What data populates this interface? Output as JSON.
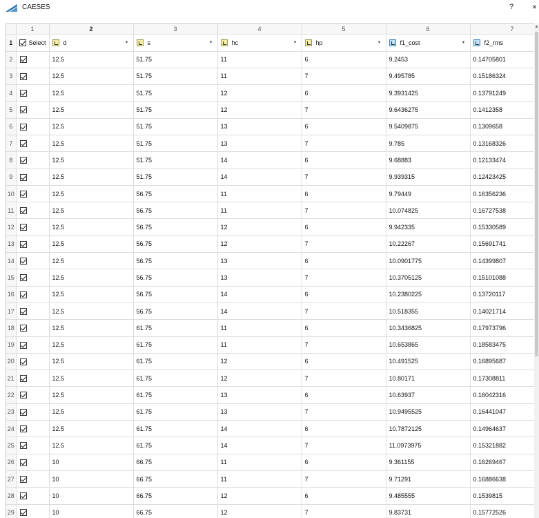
{
  "window": {
    "title": "CAESES",
    "help_label": "?",
    "close_label": "×"
  },
  "colors": {
    "accent": "#1f6fb5",
    "input_icon": "#f3eba6",
    "output_icon": "#bfe0f5"
  },
  "column_numbers": [
    "1",
    "2",
    "3",
    "4",
    "5",
    "6",
    "7"
  ],
  "header_row_number": "1",
  "select_label": "Select",
  "columns": [
    {
      "name": "d",
      "icon": "input-variable-icon"
    },
    {
      "name": "s",
      "icon": "input-variable-icon"
    },
    {
      "name": "hc",
      "icon": "input-variable-icon"
    },
    {
      "name": "hp",
      "icon": "input-variable-icon"
    },
    {
      "name": "f1_cost",
      "icon": "output-variable-icon"
    },
    {
      "name": "f2_rms",
      "icon": "output-variable-icon"
    }
  ],
  "rows": [
    {
      "n": "2",
      "selected": true,
      "cells": [
        "12.5",
        "51.75",
        "11",
        "6",
        "9.2453",
        "0.14705801"
      ]
    },
    {
      "n": "3",
      "selected": true,
      "cells": [
        "12.5",
        "51.75",
        "11",
        "7",
        "9.495785",
        "0.15186324"
      ]
    },
    {
      "n": "4",
      "selected": true,
      "cells": [
        "12.5",
        "51.75",
        "12",
        "6",
        "9.3931425",
        "0.13791249"
      ]
    },
    {
      "n": "5",
      "selected": true,
      "cells": [
        "12.5",
        "51.75",
        "12",
        "7",
        "9.6436275",
        "0.1412358"
      ]
    },
    {
      "n": "6",
      "selected": true,
      "cells": [
        "12.5",
        "51.75",
        "13",
        "6",
        "9.5409875",
        "0.1309658"
      ]
    },
    {
      "n": "7",
      "selected": true,
      "cells": [
        "12.5",
        "51.75",
        "13",
        "7",
        "9.785",
        "0.13168326"
      ]
    },
    {
      "n": "8",
      "selected": true,
      "cells": [
        "12.5",
        "51.75",
        "14",
        "6",
        "9.68883",
        "0.12133474"
      ]
    },
    {
      "n": "9",
      "selected": true,
      "cells": [
        "12.5",
        "51.75",
        "14",
        "7",
        "9.939315",
        "0.12423425"
      ]
    },
    {
      "n": "10",
      "selected": true,
      "cells": [
        "12.5",
        "56.75",
        "11",
        "6",
        "9.79449",
        "0.16356236"
      ]
    },
    {
      "n": "11",
      "selected": true,
      "cells": [
        "12.5",
        "56.75",
        "11",
        "7",
        "10.074825",
        "0.16727538"
      ]
    },
    {
      "n": "12",
      "selected": true,
      "cells": [
        "12.5",
        "56.75",
        "12",
        "6",
        "9.942335",
        "0.15330589"
      ]
    },
    {
      "n": "13",
      "selected": true,
      "cells": [
        "12.5",
        "56.75",
        "12",
        "7",
        "10.22267",
        "0.15691741"
      ]
    },
    {
      "n": "14",
      "selected": true,
      "cells": [
        "12.5",
        "56.75",
        "13",
        "6",
        "10.0901775",
        "0.14399807"
      ]
    },
    {
      "n": "15",
      "selected": true,
      "cells": [
        "12.5",
        "56.75",
        "13",
        "7",
        "10.3705125",
        "0.15101088"
      ]
    },
    {
      "n": "16",
      "selected": true,
      "cells": [
        "12.5",
        "56.75",
        "14",
        "6",
        "10.2380225",
        "0.13720117"
      ]
    },
    {
      "n": "17",
      "selected": true,
      "cells": [
        "12.5",
        "56.75",
        "14",
        "7",
        "10.518355",
        "0.14021714"
      ]
    },
    {
      "n": "18",
      "selected": true,
      "cells": [
        "12.5",
        "61.75",
        "11",
        "6",
        "10.3436825",
        "0.17973796"
      ]
    },
    {
      "n": "19",
      "selected": true,
      "cells": [
        "12.5",
        "61.75",
        "11",
        "7",
        "10.653865",
        "0.18583475"
      ]
    },
    {
      "n": "20",
      "selected": true,
      "cells": [
        "12.5",
        "61.75",
        "12",
        "6",
        "10.491525",
        "0.16895687"
      ]
    },
    {
      "n": "21",
      "selected": true,
      "cells": [
        "12.5",
        "61.75",
        "12",
        "7",
        "10.80171",
        "0.17308811"
      ]
    },
    {
      "n": "22",
      "selected": true,
      "cells": [
        "12.5",
        "61.75",
        "13",
        "6",
        "10.63937",
        "0.16042316"
      ]
    },
    {
      "n": "23",
      "selected": true,
      "cells": [
        "12.5",
        "61.75",
        "13",
        "7",
        "10.9495525",
        "0.16441047"
      ]
    },
    {
      "n": "24",
      "selected": true,
      "cells": [
        "12.5",
        "61.75",
        "14",
        "6",
        "10.7872125",
        "0.14964637"
      ]
    },
    {
      "n": "25",
      "selected": true,
      "cells": [
        "12.5",
        "61.75",
        "14",
        "7",
        "11.0973975",
        "0.15321882"
      ]
    },
    {
      "n": "26",
      "selected": true,
      "cells": [
        "10",
        "66.75",
        "11",
        "6",
        "9.361155",
        "0.16269467"
      ]
    },
    {
      "n": "27",
      "selected": true,
      "cells": [
        "10",
        "66.75",
        "11",
        "7",
        "9.71291",
        "0.16886638"
      ]
    },
    {
      "n": "28",
      "selected": true,
      "cells": [
        "10",
        "66.75",
        "12",
        "6",
        "9.485555",
        "0.1539815"
      ]
    },
    {
      "n": "29",
      "selected": true,
      "cells": [
        "10",
        "66.75",
        "12",
        "7",
        "9.83731",
        "0.15772526"
      ]
    }
  ]
}
